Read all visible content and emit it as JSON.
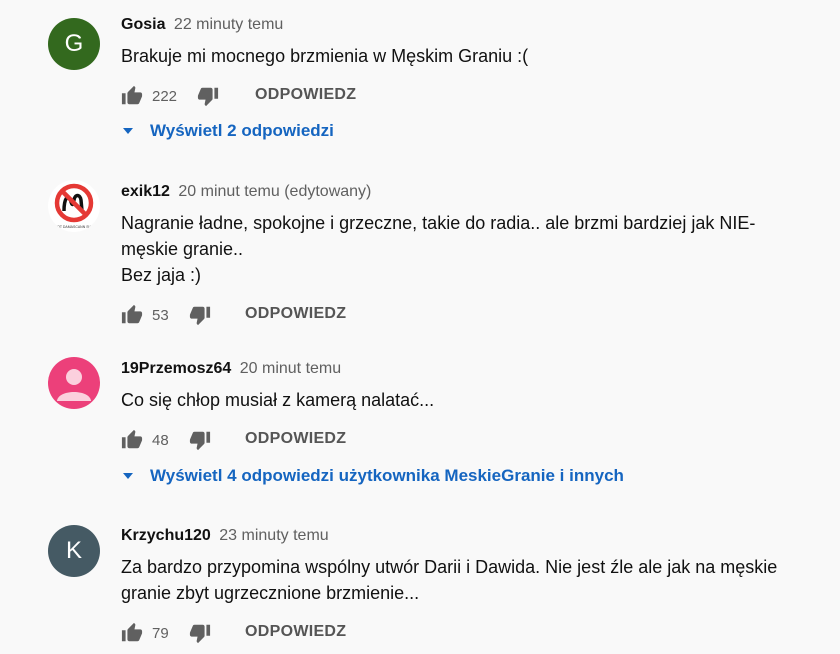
{
  "comments": [
    {
      "author": "Gosia",
      "time": "22 minuty temu",
      "avatar_letter": "G",
      "avatar_color": "#33691e",
      "text": "Brakuje mi mocnego brzmienia w Męskim Graniu :(",
      "likes": "222",
      "reply_label": "ODPOWIEDZ",
      "replies_label": "Wyświetl 2 odpowiedzi"
    },
    {
      "author": "exik12",
      "time": "20 minut temu (edytowany)",
      "avatar_icon": "no-m-sign-icon",
      "avatar_caption": "NOT DAMASCANN SUP",
      "text": "Nagranie ładne, spokojne i grzeczne, takie do radia.. ale brzmi bardziej jak NIE-\nmęskie granie..\nBez jaja :)",
      "likes": "53",
      "reply_label": "ODPOWIEDZ"
    },
    {
      "author": "19Przemosz64",
      "time": "20 minut temu",
      "avatar_icon": "default-user-icon",
      "avatar_color": "#ec407a",
      "text": "Co się chłop musiał z kamerą nalatać...",
      "likes": "48",
      "reply_label": "ODPOWIEDZ",
      "replies_label": "Wyświetl 4 odpowiedzi użytkownika MeskieGranie i innych"
    },
    {
      "author": "Krzychu120",
      "time": "23 minuty temu",
      "avatar_letter": "K",
      "avatar_color": "#455a64",
      "text": "Za bardzo przypomina wspólny utwór Darii i Dawida. Nie jest źle ale jak na męskie\ngranie zbyt ugrzecznione brzmienie...",
      "likes": "79",
      "reply_label": "ODPOWIEDZ"
    }
  ],
  "colors": {
    "background": "#f9f9f9",
    "link": "#1565c0",
    "meta": "#606060",
    "icon": "#606060"
  }
}
